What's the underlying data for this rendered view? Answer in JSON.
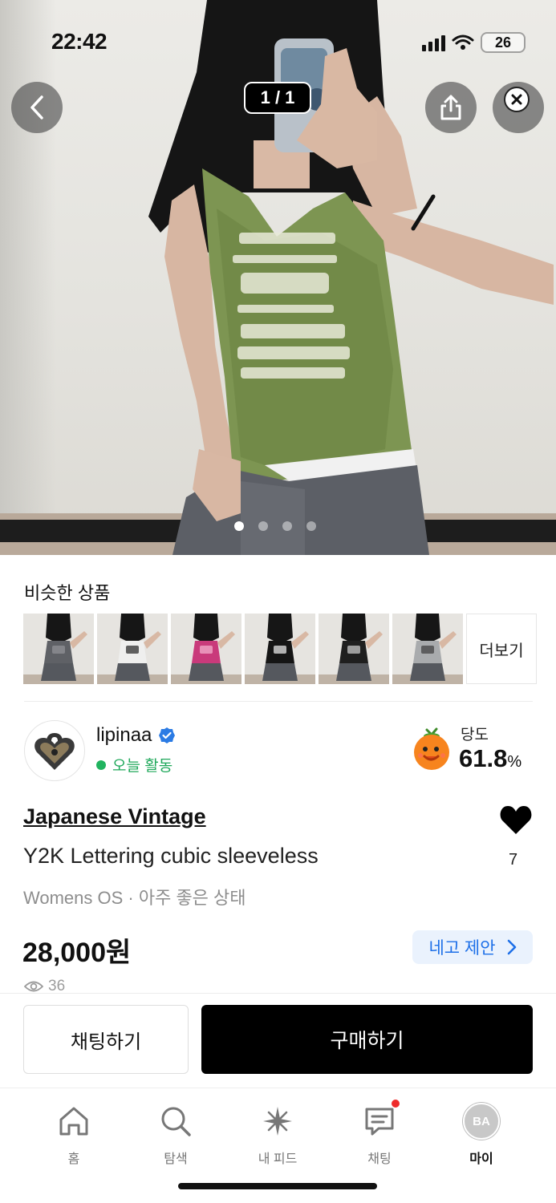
{
  "status_bar": {
    "time": "22:42",
    "battery": "26"
  },
  "gallery": {
    "counter": "1 / 1"
  },
  "similar": {
    "title": "비슷한 상품",
    "more_label": "더보기",
    "thumbs": [
      {
        "top_color": "#5f6166",
        "accent": "#8d8f93"
      },
      {
        "top_color": "#efefee",
        "accent": "#3b3b3b"
      },
      {
        "top_color": "#c93a7b",
        "accent": "#f0a8c8"
      },
      {
        "top_color": "#151515",
        "accent": "#d8d8d8"
      },
      {
        "top_color": "#1f1f1f",
        "accent": "#bdbdbd"
      },
      {
        "top_color": "#a9abad",
        "accent": "#4a4a4a"
      }
    ]
  },
  "seller": {
    "name": "lipinaa",
    "status": "오늘 활동",
    "sweetness_label": "당도",
    "sweetness_value": "61.8",
    "sweetness_unit": "%"
  },
  "product": {
    "brand": "Japanese Vintage",
    "title": "Y2K Lettering cubic sleeveless",
    "meta": "Womens OS · 아주 좋은 상태",
    "price": "28,000원",
    "likes": "7",
    "views": "36",
    "offer_label": "네고 제안"
  },
  "actions": {
    "chat_label": "채팅하기",
    "buy_label": "구매하기"
  },
  "nav": {
    "home": "홈",
    "search": "탐색",
    "feed": "내 피드",
    "chat": "채팅",
    "my": "마이",
    "avatar_initials": "BA"
  },
  "colors": {
    "accent_blue": "#1c6fe8",
    "status_green": "#21b35f",
    "notification_red": "#ee2b2b"
  }
}
